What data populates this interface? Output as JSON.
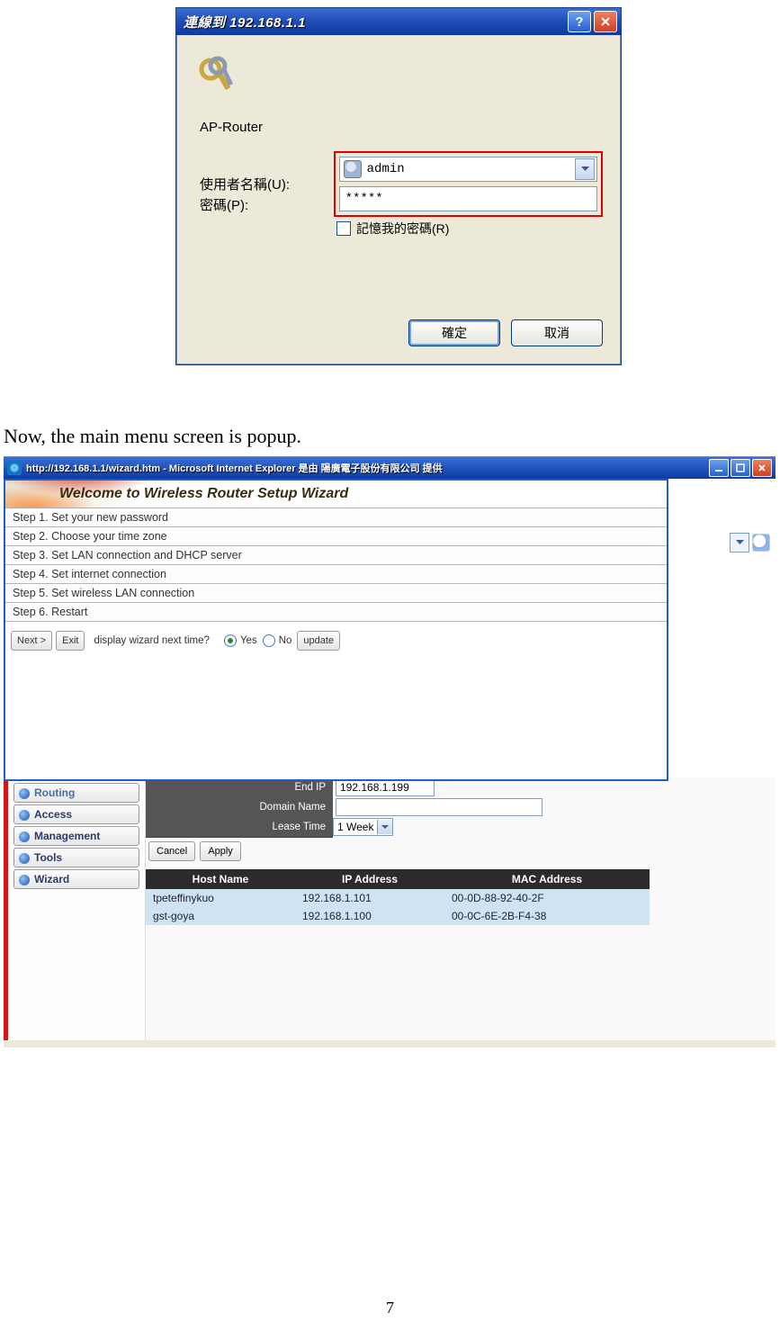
{
  "login_dialog": {
    "title": "連線到 192.168.1.1",
    "realm": "AP-Router",
    "labels": {
      "username": "使用者名稱(U):",
      "password": "密碼(P):"
    },
    "username_value": "admin",
    "password_value": "*****",
    "remember_label": "記憶我的密碼(R)",
    "ok": "確定",
    "cancel": "取消"
  },
  "body_text": "Now, the main menu screen is popup.",
  "browser": {
    "title": "http://192.168.1.1/wizard.htm - Microsoft Internet Explorer 是由 陽廣電子股份有限公司 提供"
  },
  "wizard": {
    "banner": "Welcome to Wireless Router Setup Wizard",
    "steps": [
      "Step 1. Set your new password",
      "Step 2. Choose your time zone",
      "Step 3. Set LAN connection and DHCP server",
      "Step 4. Set internet connection",
      "Step 5. Set wireless LAN connection",
      "Step 6. Restart"
    ],
    "next": "Next >",
    "exit": "Exit",
    "question": "display wizard next time?",
    "yes": "Yes",
    "no": "No",
    "update": "update"
  },
  "sidebar": {
    "items": [
      "Routing",
      "Access",
      "Management",
      "Tools",
      "Wizard"
    ]
  },
  "config": {
    "end_ip_label": "End IP",
    "end_ip_value": "192.168.1.199",
    "domain_name_label": "Domain Name",
    "domain_name_value": "",
    "lease_time_label": "Lease Time",
    "lease_time_value": "1 Week",
    "cancel": "Cancel",
    "apply": "Apply"
  },
  "dhcp_table": {
    "headers": [
      "Host Name",
      "IP Address",
      "MAC Address"
    ],
    "rows": [
      {
        "host": "tpeteffinykuo",
        "ip": "192.168.1.101",
        "mac": "00-0D-88-92-40-2F"
      },
      {
        "host": "gst-goya",
        "ip": "192.168.1.100",
        "mac": "00-0C-6E-2B-F4-38"
      }
    ]
  },
  "page_number": "7"
}
